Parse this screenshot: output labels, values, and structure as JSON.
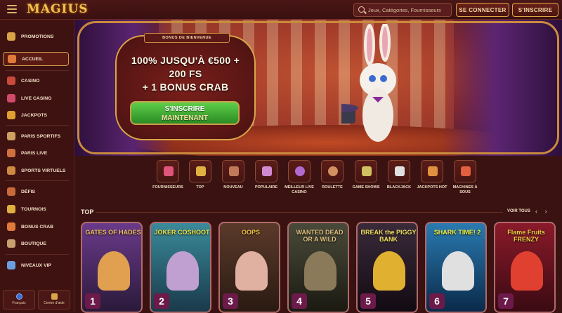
{
  "header": {
    "logo": "MAGIUS",
    "search_placeholder": "Jeux, Catégories, Fournisseurs",
    "login_label": "SE CONNECTER",
    "signup_label": "S'INSCRIRE"
  },
  "sidebar": {
    "items": [
      {
        "label": "PROMOTIONS",
        "color": "#d9a547"
      },
      {
        "label": "ACCUEIL",
        "color": "#e07a3a",
        "active": true
      },
      {
        "label": "CASINO",
        "color": "#c84a3a"
      },
      {
        "label": "LIVE CASINO",
        "color": "#d04a6a"
      },
      {
        "label": "JACKPOTS",
        "color": "#e0a030"
      },
      {
        "label": "PARIS SPORTIFS",
        "color": "#d0a060"
      },
      {
        "label": "PARIS LIVE",
        "color": "#d07040"
      },
      {
        "label": "SPORTS VIRTUELS",
        "color": "#d08a40"
      },
      {
        "label": "DÉFIS",
        "color": "#c86a3a"
      },
      {
        "label": "TOURNOIS",
        "color": "#e0b040"
      },
      {
        "label": "BONUS CRAB",
        "color": "#e07a3a"
      },
      {
        "label": "BOUTIQUE",
        "color": "#c8a070"
      },
      {
        "label": "NIVEAUX VIP",
        "color": "#6aa0e0"
      }
    ],
    "language_label": "Français",
    "help_label": "Centre d'aide"
  },
  "hero": {
    "tag": "BONUS DE BIENVENUE",
    "line1": "100% JUSQU'À €500 +",
    "line2": "200 FS",
    "line3": "+ 1 BONUS CRAB",
    "cta_line1": "S'INSCRIRE",
    "cta_line2": "MAINTENANT"
  },
  "categories": [
    {
      "label": "FOURNISSEURS",
      "color": "#e0557a"
    },
    {
      "label": "TOP",
      "color": "#e0b040"
    },
    {
      "label": "NOUVEAU",
      "color": "#c07a5a"
    },
    {
      "label": "POPULAIRE",
      "color": "#d08ad0"
    },
    {
      "label": "MEILLEUR LIVE CASINO",
      "color": "#b06ad0"
    },
    {
      "label": "ROULETTE",
      "color": "#d09060"
    },
    {
      "label": "GAME SHOWS",
      "color": "#d0c060"
    },
    {
      "label": "BLACKJACK",
      "color": "#e0e0e0"
    },
    {
      "label": "JACKPOTS HOT",
      "color": "#e09040"
    },
    {
      "label": "MACHINES À SOUS",
      "color": "#e06040"
    }
  ],
  "section": {
    "title": "TOP",
    "view_all": "VOIR TOUS",
    "arrows": "‹ ›"
  },
  "games": [
    {
      "rank": "1",
      "title": "GATES OF HADES",
      "bg": "#6a3a8a",
      "fig": "#e0a050"
    },
    {
      "rank": "2",
      "title": "JOKER COSHOOT",
      "bg": "#3a8a9a",
      "fig": "#c0a0d0"
    },
    {
      "rank": "3",
      "title": "OOPS",
      "bg": "#5a3a2a",
      "fig": "#e0b0a0"
    },
    {
      "rank": "4",
      "title": "WANTED DEAD OR A WILD",
      "bg": "#4a4a3a",
      "fig": "#8a7a5a"
    },
    {
      "rank": "5",
      "title": "BREAK the PIGGY BANK",
      "bg": "#3a2a3a",
      "fig": "#e0b030"
    },
    {
      "rank": "6",
      "title": "SHARK TIME! 2",
      "bg": "#2a7ab0",
      "fig": "#e0e0e0"
    },
    {
      "rank": "7",
      "title": "Flame Fruits FRENZY",
      "bg": "#8a1a2a",
      "fig": "#e04030"
    }
  ]
}
